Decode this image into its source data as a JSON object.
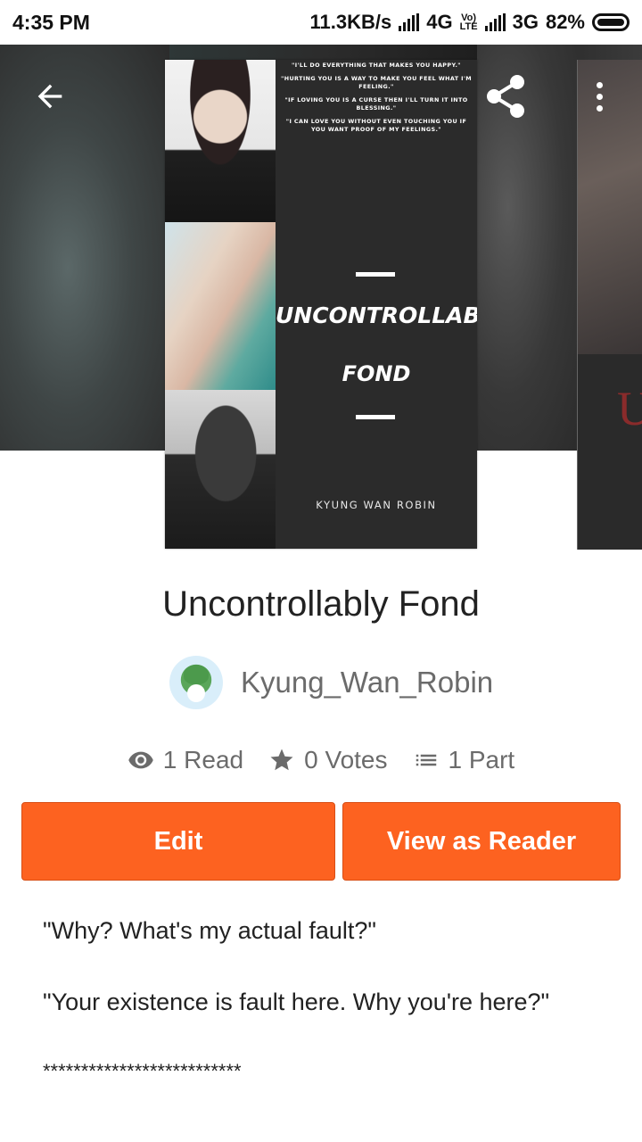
{
  "status_bar": {
    "time": "4:35 PM",
    "network_speed": "11.3KB/s",
    "network_1": "4G",
    "volte_top": "Vo)",
    "volte_bottom": "LTE",
    "network_2": "3G",
    "battery": "82%"
  },
  "toolbar": {
    "back_icon": "arrow-back-icon",
    "share_icon": "share-icon",
    "more_icon": "more-vertical-icon"
  },
  "cover": {
    "quotes": [
      "\"I'LL DO EVERYTHING THAT MAKES YOU HAPPY.\"",
      "\"HURTING YOU IS A WAY TO MAKE YOU FEEL WHAT I'M FEELING.\"",
      "\"IF LOVING YOU IS A CURSE THEN I'LL TURN IT INTO BLESSING.\"",
      "\"I CAN LOVE YOU WITHOUT EVEN TOUCHING YOU IF YOU WANT PROOF OF MY FEELINGS.\""
    ],
    "title_line_1": "UNCONTROLLABLY",
    "title_line_2": "FOND",
    "author": "KYUNG WAN ROBIN",
    "next_cover_letter": "U"
  },
  "book": {
    "title": "Uncontrollably Fond",
    "author": "Kyung_Wan_Robin"
  },
  "stats": {
    "reads": "1 Read",
    "votes": "0 Votes",
    "parts": "1 Part"
  },
  "actions": {
    "edit_label": "Edit",
    "view_reader_label": "View as Reader"
  },
  "description": {
    "line_1": "\"Why? What's my actual fault?\"",
    "line_2": "\"Your existence is fault here. Why you're here?\"",
    "line_3": "**************************"
  },
  "colors": {
    "accent": "#fd6220",
    "hero_background": "#2c2c2c",
    "secondary_text": "#6b6b6b"
  }
}
